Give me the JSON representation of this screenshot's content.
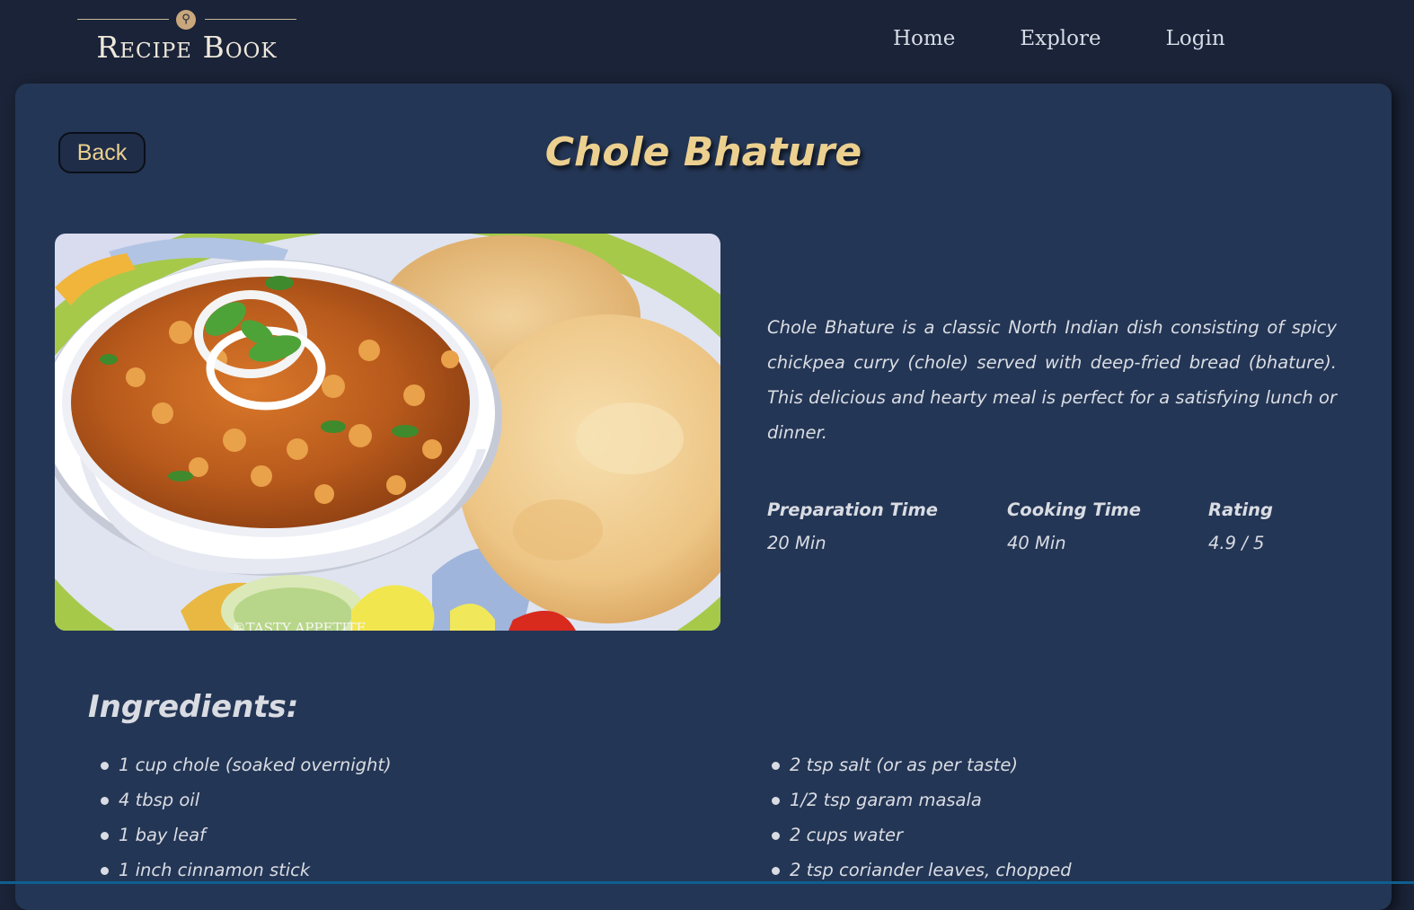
{
  "navbar": {
    "logo_text": "Recipe Book",
    "links": [
      {
        "label": "Home"
      },
      {
        "label": "Explore"
      },
      {
        "label": "Login"
      }
    ]
  },
  "recipe": {
    "back_label": "Back",
    "title": "Chole Bhature",
    "photo_watermark": "©TASTY APPETITE",
    "description": "Chole Bhature is a classic North Indian dish consisting of spicy chickpea curry (chole) served with deep-fried bread (bhature). This delicious and hearty meal is perfect for a satisfying lunch or dinner.",
    "stats": [
      {
        "label": "Preparation Time",
        "value": "20 Min"
      },
      {
        "label": "Cooking Time",
        "value": "40 Min"
      },
      {
        "label": "Rating",
        "value": "4.9 / 5"
      }
    ]
  },
  "ingredients": {
    "heading": "Ingredients:",
    "left": [
      "1 cup chole (soaked overnight)",
      "4 tbsp oil",
      "1 bay leaf",
      "1 inch cinnamon stick"
    ],
    "right": [
      "2 tsp salt (or as per taste)",
      "1/2 tsp garam masala",
      "2 cups water",
      "2 tsp coriander leaves, chopped"
    ]
  },
  "colors": {
    "navbar_bg": "#1a2337",
    "card_bg": "#243655",
    "accent_gold": "#ecd08f",
    "text": "#d9dce3"
  }
}
